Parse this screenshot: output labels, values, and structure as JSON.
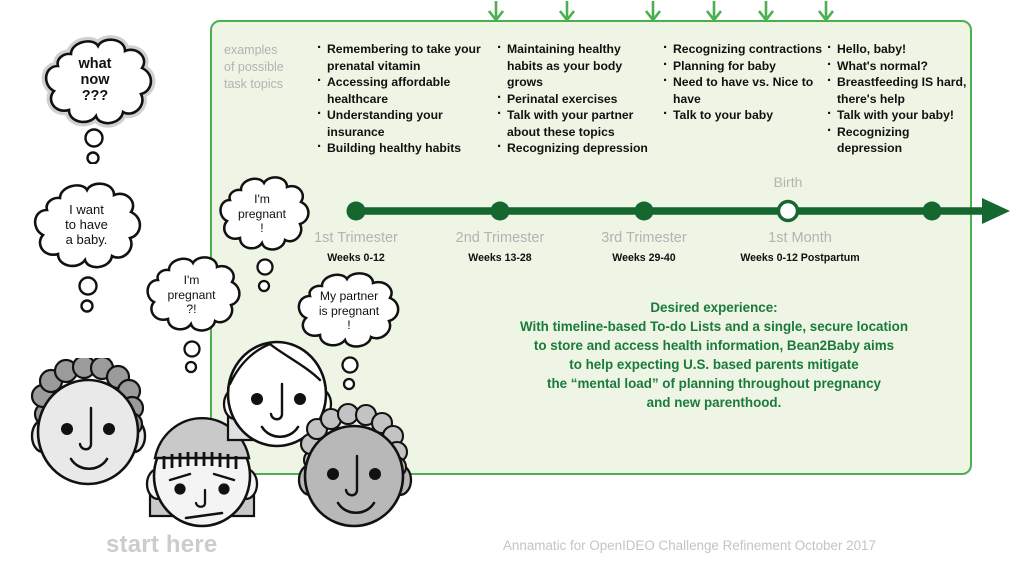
{
  "panel": {
    "accent_green": "#4caf50",
    "panel_bg": "#eef5e4",
    "timeline_green": "#15662f",
    "text_green": "#1a7a3c",
    "muted_gray": "#b3b3b3"
  },
  "topics": {
    "label_lines": [
      "examples",
      "of possible",
      "task topics"
    ],
    "columns": [
      {
        "stage": "1st Trimester",
        "items": [
          "Remembering to take your prenatal vitamin",
          "Accessing affordable healthcare",
          "Understanding your insurance",
          "Building healthy habits"
        ]
      },
      {
        "stage": "2nd Trimester",
        "items": [
          "Maintaining healthy habits as your body grows",
          "Perinatal exercises",
          "Talk with your partner about these topics",
          "Recognizing depression"
        ]
      },
      {
        "stage": "3rd Trimester",
        "items": [
          "Recognizing contractions",
          "Planning for baby",
          "Need to have vs. Nice to have",
          "Talk to your baby"
        ]
      },
      {
        "stage": "1st Month",
        "items": [
          "Hello, baby!",
          "What's normal?",
          "Breastfeeding IS hard, there's help",
          "Talk with your baby!",
          "Recognizing depression"
        ]
      }
    ]
  },
  "timeline": {
    "birth_label": "Birth",
    "milestones": [
      {
        "label": "1st Trimester",
        "weeks": "Weeks 0-12"
      },
      {
        "label": "2nd Trimester",
        "weeks": "Weeks 13-28"
      },
      {
        "label": "3rd Trimester",
        "weeks": "Weeks 29-40"
      },
      {
        "label": "1st Month",
        "weeks": "Weeks 0-12 Postpartum"
      }
    ]
  },
  "desired_experience": {
    "heading": "Desired experience:",
    "lines": [
      "With timeline-based To-do Lists and a single, secure location",
      "to store and access health information, Bean2Baby aims",
      "to help expecting U.S. based parents mitigate",
      "the “mental load” of planning throughout pregnancy",
      "and new parenthood."
    ]
  },
  "bubbles": [
    {
      "id": "what-now",
      "lines": [
        "what",
        "now",
        "???"
      ]
    },
    {
      "id": "want-baby",
      "lines": [
        "I want",
        "to have",
        "a baby."
      ]
    },
    {
      "id": "im-pregnant-q",
      "lines": [
        "I'm",
        "pregnant",
        "?!"
      ]
    },
    {
      "id": "im-pregnant-excl",
      "lines": [
        "I'm",
        "pregnant",
        "!"
      ]
    },
    {
      "id": "my-partner-pregnant",
      "lines": [
        "My partner",
        "is pregnant",
        "!"
      ]
    }
  ],
  "footer": {
    "start_here": "start here",
    "credit": "Annamatic for OpenIDEO Challenge Refinement October 2017"
  }
}
